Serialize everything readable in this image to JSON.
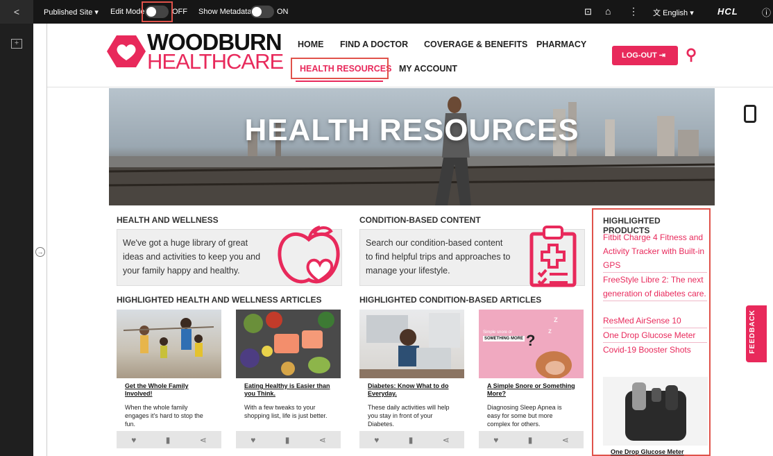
{
  "topbar": {
    "back_glyph": "<",
    "published_site": "Published Site",
    "edit_mode_label": "Edit Mode:",
    "edit_mode_state": "OFF",
    "show_metadata_label": "Show Metadata:",
    "show_metadata_state": "ON",
    "language": "English",
    "brand": "HCL"
  },
  "logo": {
    "line1": "WOODBURN",
    "line2": "HEALTHCARE"
  },
  "nav": {
    "home": "HOME",
    "find_doctor": "FIND A DOCTOR",
    "coverage": "COVERAGE & BENEFITS",
    "pharmacy": "PHARMACY",
    "health_resources": "HEALTH RESOURCES",
    "my_account": "MY ACCOUNT",
    "logout": "LOG-OUT"
  },
  "hero": {
    "title": "HEALTH RESOURCES"
  },
  "health_wellness": {
    "title": "HEALTH AND WELLNESS",
    "text": "We've got a huge library of great ideas and activities to keep you and your family happy and healthy."
  },
  "condition": {
    "title": "CONDITION-BASED CONTENT",
    "text": "Search our condition-based content to find helpful trips and approaches to manage your lifestyle."
  },
  "hw_articles": {
    "title": "HIGHLIGHTED HEALTH AND WELLNESS ARTICLES",
    "cards": [
      {
        "title": "Get the Whole Family Involved!",
        "desc": "When the whole family engages it's hard to stop the fun."
      },
      {
        "title": "Eating Healthy is Easier than you Think.",
        "desc": "With a few tweaks to your shopping list, life is just better."
      }
    ]
  },
  "cb_articles": {
    "title": "HIGHLIGHTED CONDITION-BASED ARTICLES",
    "cards": [
      {
        "title": "Diabetes: Know What to do Everyday.",
        "desc": "These daily activities will help you stay in front of your Diabetes."
      },
      {
        "title": "A Simple Snore or Something More?",
        "desc": "Diagnosing Sleep Apnea is easy for some but more complex for others.",
        "img_text1": "Simple snore or",
        "img_text2": "SOMETHING MORE"
      }
    ]
  },
  "products": {
    "title": "HIGHLIGHTED PRODUCTS",
    "items": [
      "Fitbit Charge 4 Fitness and Activity Tracker with Built-in GPS",
      "FreeStyle Libre 2: The next generation of diabetes care.",
      "ResMed AirSense 10",
      "One Drop Glucose Meter",
      "Covid-19 Booster Shots"
    ],
    "featured_caption": "One Drop Glucose Meter"
  },
  "feedback": "FEEDBACK",
  "colors": {
    "brand": "#e8295b",
    "highlight_box": "#e0524a",
    "topbar": "#161616"
  }
}
